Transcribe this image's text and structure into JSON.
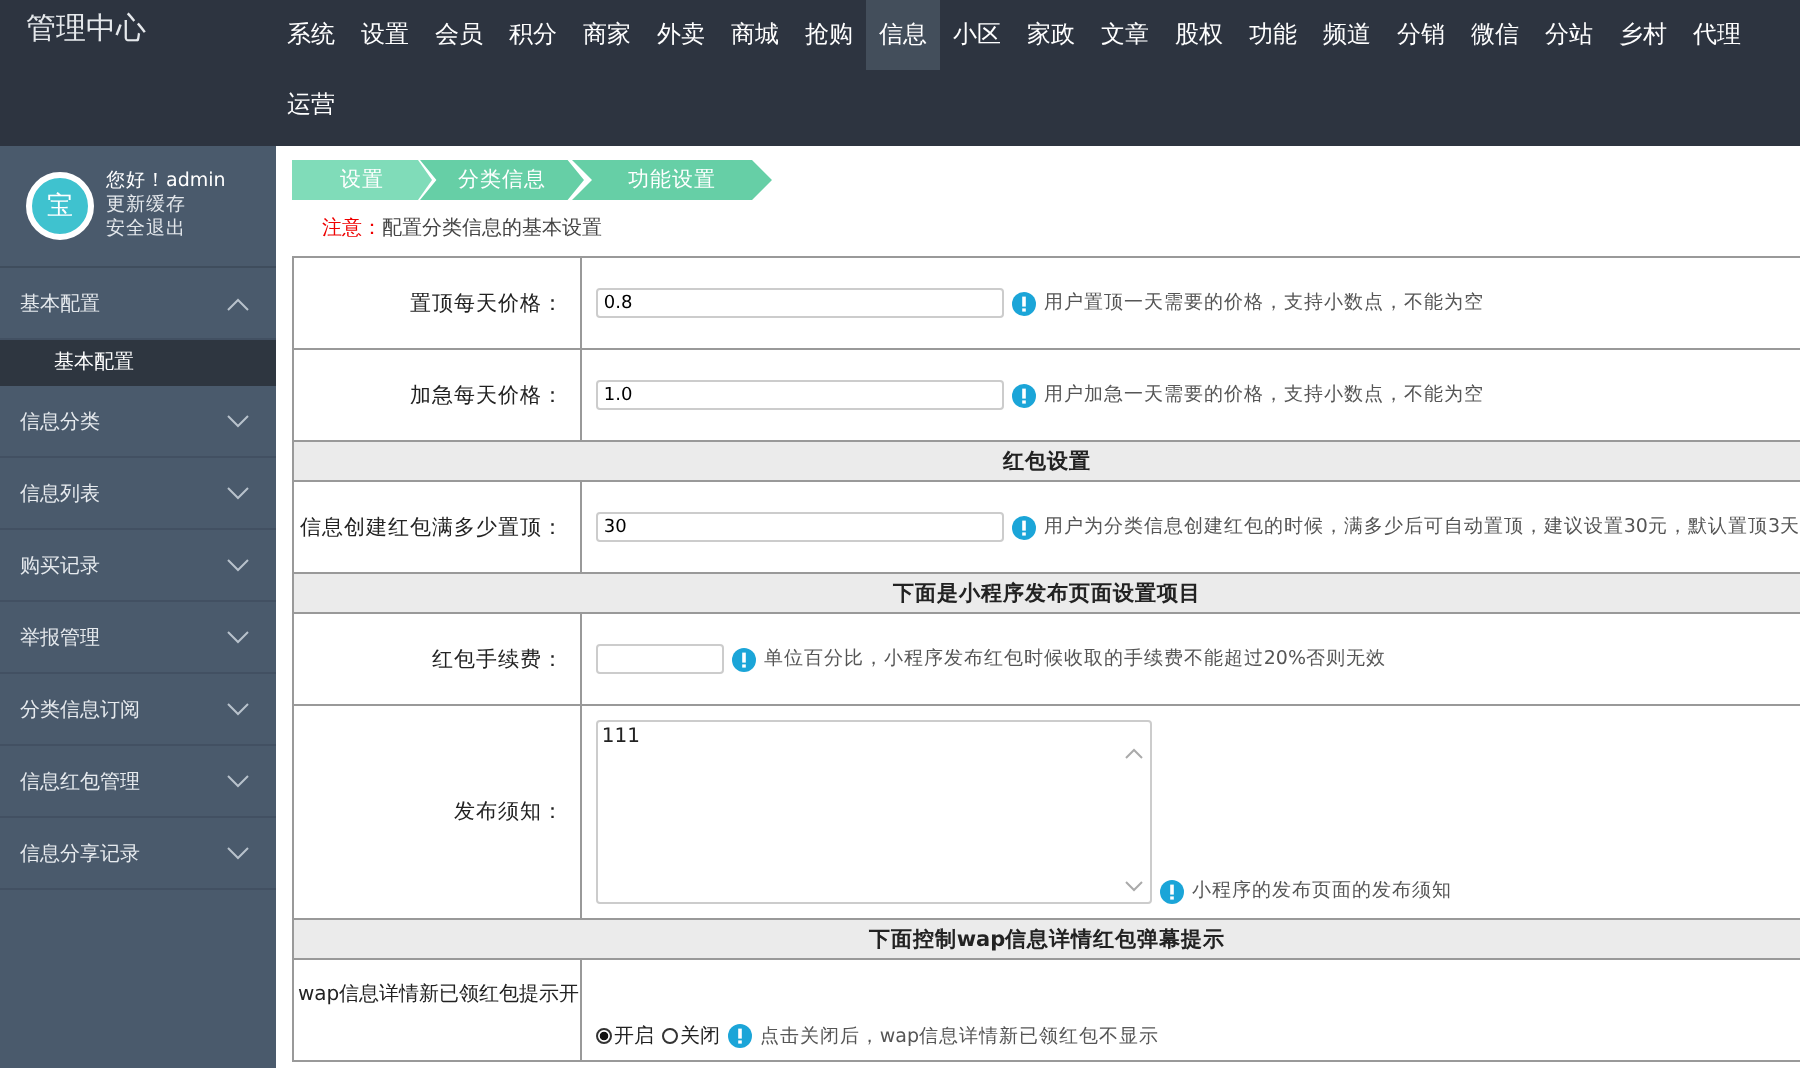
{
  "header": {
    "title": "管理中心",
    "nav": [
      {
        "label": "系统",
        "selected": false
      },
      {
        "label": "设置",
        "selected": false
      },
      {
        "label": "会员",
        "selected": false
      },
      {
        "label": "积分",
        "selected": false
      },
      {
        "label": "商家",
        "selected": false
      },
      {
        "label": "外卖",
        "selected": false
      },
      {
        "label": "商城",
        "selected": false
      },
      {
        "label": "抢购",
        "selected": false
      },
      {
        "label": "信息",
        "selected": true
      },
      {
        "label": "小区",
        "selected": false
      },
      {
        "label": "家政",
        "selected": false
      },
      {
        "label": "文章",
        "selected": false
      },
      {
        "label": "股权",
        "selected": false
      },
      {
        "label": "功能",
        "selected": false
      },
      {
        "label": "频道",
        "selected": false
      },
      {
        "label": "分销",
        "selected": false
      },
      {
        "label": "微信",
        "selected": false
      },
      {
        "label": "分站",
        "selected": false
      },
      {
        "label": "乡村",
        "selected": false
      },
      {
        "label": "代理",
        "selected": false
      },
      {
        "label": "运营",
        "selected": false
      }
    ]
  },
  "user": {
    "avatar": "宝",
    "greeting": "您好！admin",
    "links": [
      "更新缓存",
      "安全退出"
    ]
  },
  "sidebar": {
    "items": [
      {
        "label": "基本配置",
        "expanded": true,
        "children": [
          {
            "label": "基本配置",
            "selected": true
          }
        ]
      },
      {
        "label": "信息分类",
        "expanded": false
      },
      {
        "label": "信息列表",
        "expanded": false
      },
      {
        "label": "购买记录",
        "expanded": false
      },
      {
        "label": "举报管理",
        "expanded": false
      },
      {
        "label": "分类信息订阅",
        "expanded": false
      },
      {
        "label": "信息红包管理",
        "expanded": false
      },
      {
        "label": "信息分享记录",
        "expanded": false
      }
    ]
  },
  "breadcrumb": [
    "设置",
    "分类信息",
    "功能设置"
  ],
  "notice": {
    "label": "注意：",
    "text": "配置分类信息的基本设置"
  },
  "form": {
    "rows": [
      {
        "kind": "input",
        "label": "置顶每天价格：",
        "value": "0.8",
        "hint": "用户置顶一天需要的价格，支持小数点，不能为空"
      },
      {
        "kind": "input",
        "label": "加急每天价格：",
        "value": "1.0",
        "hint": "用户加急一天需要的价格，支持小数点，不能为空"
      },
      {
        "kind": "section",
        "title": "红包设置"
      },
      {
        "kind": "input",
        "label": "信息创建红包满多少置顶：",
        "value": "30",
        "hint": "用户为分类信息创建红包的时候，满多少后可自动置顶，建议设置30元，默认置顶3天"
      },
      {
        "kind": "section",
        "title": "下面是小程序发布页面设置项目"
      },
      {
        "kind": "short",
        "label": "红包手续费：",
        "value": "",
        "hint": "单位百分比，小程序发布红包时候收取的手续费不能超过20%否则无效"
      },
      {
        "kind": "textarea",
        "label": "发布须知：",
        "value": "111",
        "hint": "小程序的发布页面的发布须知"
      },
      {
        "kind": "section",
        "title": "下面控制wap信息详情红包弹幕提示"
      },
      {
        "kind": "radio",
        "label": "wap信息详情新已领红包提示开",
        "options": [
          {
            "label": "开启",
            "selected": true
          },
          {
            "label": "关闭",
            "selected": false
          }
        ],
        "hint": "点击关闭后，wap信息详情新已领红包不显示"
      }
    ]
  }
}
